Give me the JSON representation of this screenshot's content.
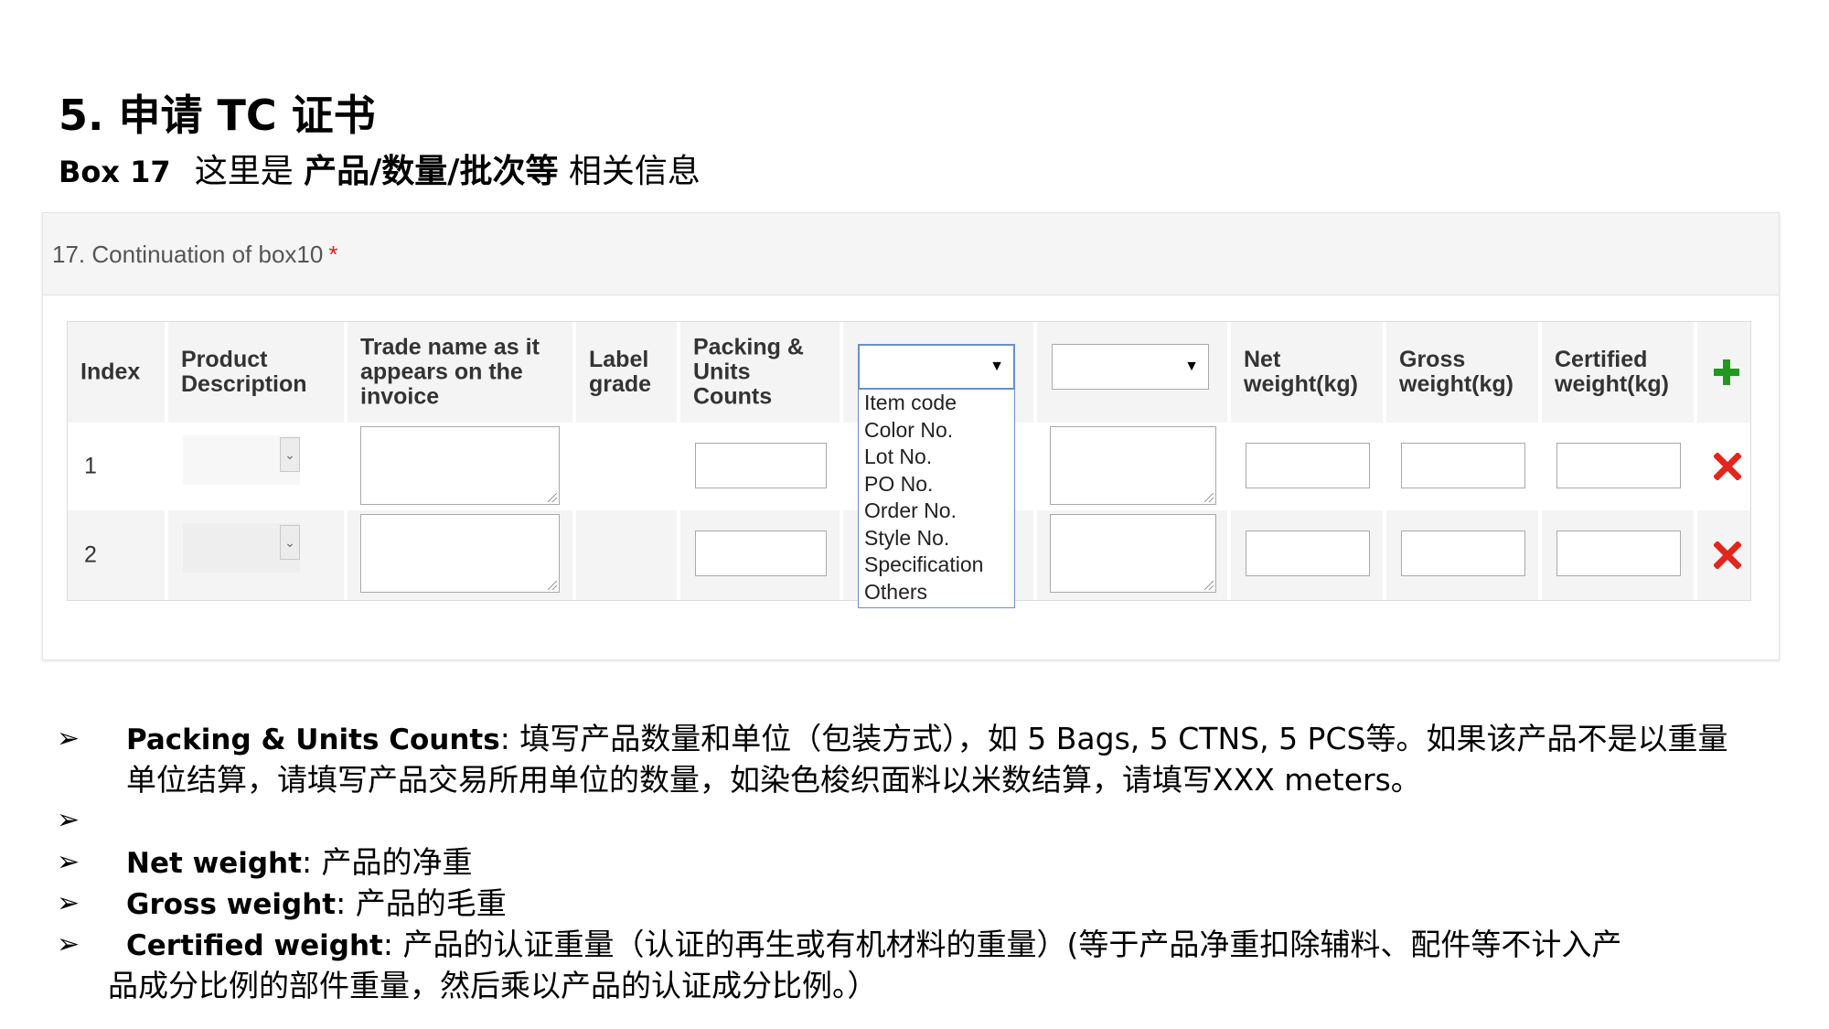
{
  "slide": {
    "title": "5. 申请 TC 证书",
    "subtitle": {
      "box_label": "Box 17",
      "prefix": "这里是 ",
      "bold": "产品/数量/批次等",
      "suffix": " 相关信息"
    }
  },
  "panel": {
    "header": "17. Continuation of box10",
    "required_mark": "*"
  },
  "table": {
    "headers": {
      "index": "Index",
      "product": "Product\nDescription",
      "trade_name": "Trade name as it\nappears on the\ninvoice",
      "label_grade": "Label\ngrade",
      "packing": "Packing &\nUnits\nCounts",
      "net": "Net\nweight(kg)",
      "gross": "Gross\nweight(kg)",
      "certified": "Certified\nweight(kg)"
    },
    "dropdown1": {
      "selected": "",
      "options": [
        "Item code",
        "Color No.",
        "Lot No.",
        "PO No.",
        "Order No.",
        "Style No.",
        "Specification",
        "Others"
      ]
    },
    "dropdown2": {
      "selected": ""
    },
    "rows": [
      {
        "index": "1"
      },
      {
        "index": "2"
      }
    ],
    "icons": {
      "add": "plus-icon",
      "remove": "x-icon"
    },
    "colors": {
      "add": "#1f9a1f",
      "remove": "#e3251b",
      "focus": "#6a8fc8"
    }
  },
  "bullets": [
    {
      "term": "Packing & Units Counts",
      "text": ": 填写产品数量和单位（包装方式），如 5 Bags, 5 CTNS, 5 PCS等。如果该产品不是以重量",
      "text2": "单位结算，请填写产品交易所用单位的数量，如染色梭织面料以米数结算，请填写XXX meters。"
    },
    {
      "term": "",
      "text": ""
    },
    {
      "term": "Net weight",
      "text": ":  产品的净重"
    },
    {
      "term": "Gross weight",
      "text": ": 产品的毛重"
    },
    {
      "term": "Certified weight",
      "text": ": 产品的认证重量（认证的再生或有机材料的重量）(等于产品净重扣除辅料、配件等不计入产",
      "text2": "品成分比例的部件重量，然后乘以产品的认证成分比例。）"
    }
  ],
  "bullet_mark": "➢"
}
